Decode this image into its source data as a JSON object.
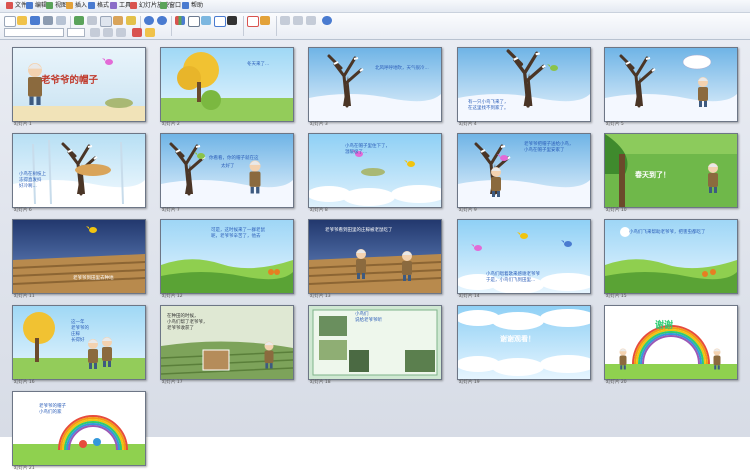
{
  "menu": [
    {
      "label": "文件",
      "color": "#d9534f"
    },
    {
      "label": "编辑",
      "color": "#4a7bd0"
    },
    {
      "label": "视图",
      "color": "#5aa35a"
    },
    {
      "label": "插入",
      "color": "#e3a23a"
    },
    {
      "label": "格式",
      "color": "#4a7bd0"
    },
    {
      "label": "工具",
      "color": "#8a6bc8"
    },
    {
      "label": "幻灯片放映",
      "color": "#d9534f"
    },
    {
      "label": "窗口",
      "color": "#5aa35a"
    },
    {
      "label": "帮助",
      "color": "#4a7bd0"
    }
  ],
  "toolbar": {
    "font_name": "",
    "font_size": ""
  },
  "slides": [
    {
      "label": "幻灯片 1",
      "texts": {
        "title": "老爷爷的帽子"
      }
    },
    {
      "label": "幻灯片 2",
      "texts": {
        "a": "冬天来了..."
      }
    },
    {
      "label": "幻灯片 3",
      "texts": {
        "a": "北风呼呼地吹，天气很冷..."
      }
    },
    {
      "label": "幻灯片 4",
      "texts": {
        "a": "有一只小鸟飞来了，",
        "b": "在这里找不到家了。"
      }
    },
    {
      "label": "幻灯片 5",
      "texts": {}
    },
    {
      "label": "幻灯片 6",
      "texts": {
        "a": "小鸟在树枝上",
        "b": "冻得直发抖",
        "c": "好冷啊..."
      }
    },
    {
      "label": "幻灯片 7",
      "texts": {
        "a": "你看看，你的帽子就在这",
        "b": "太好了"
      }
    },
    {
      "label": "幻灯片 8",
      "texts": {
        "a": "小鸟在帽子里住下了，",
        "b": "温暖极了..."
      }
    },
    {
      "label": "幻灯片 9",
      "texts": {
        "a": "老爷爷把帽子送给小鸟，",
        "b": "小鸟在帽子里安家了"
      }
    },
    {
      "label": "幻灯片 10",
      "texts": {
        "title": "春天到了！"
      }
    },
    {
      "label": "幻灯片 11",
      "texts": {
        "a": "老爷爷到田里去种地"
      }
    },
    {
      "label": "幻灯片 12",
      "texts": {
        "a": "可是，这时候来了一群老鼠",
        "b": "呢，老爷爷辛苦了，他去"
      }
    },
    {
      "label": "幻灯片 13",
      "texts": {
        "a": "老爷爷看到田里的庄稼被老鼠吃了"
      }
    },
    {
      "label": "幻灯片 14",
      "texts": {
        "a": "小鸟们唱着歌来感谢老爷爷",
        "b": "于是，小鸟们飞到田里..."
      }
    },
    {
      "label": "幻灯片 15",
      "texts": {
        "a": "小鸟们飞来帮助老爷爷，把害虫都吃了"
      }
    },
    {
      "label": "幻灯片 16",
      "texts": {
        "a": "这一年",
        "b": "老爷爷的",
        "c": "庄稼",
        "d": "长得好"
      }
    },
    {
      "label": "幻灯片 17",
      "texts": {
        "a": "在种田的时候，",
        "b": "小鸟们帮了老爷爷，",
        "c": "老爷爷收获了"
      }
    },
    {
      "label": "幻灯片 18",
      "texts": {
        "a": "小鸟们",
        "b": "说给老爷爷听"
      }
    },
    {
      "label": "幻灯片 19",
      "texts": {
        "title": "谢谢观看！"
      }
    },
    {
      "label": "幻灯片 20",
      "texts": {
        "title": "谢谢"
      }
    },
    {
      "label": "幻灯片 21",
      "texts": {
        "a": "老爷爷的帽子",
        "b": "小鸟们的家"
      }
    }
  ]
}
